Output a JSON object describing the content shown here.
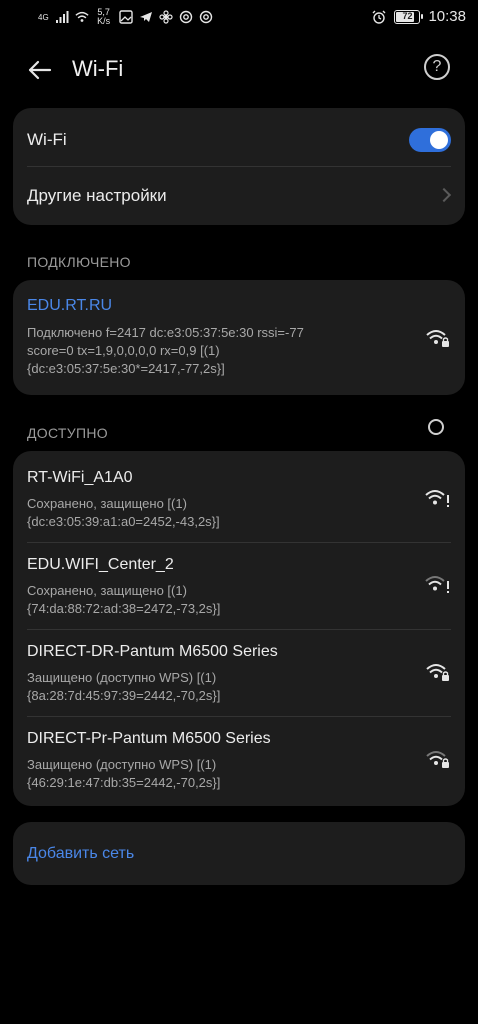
{
  "status_bar": {
    "signal_label": "4G",
    "net_speed_top": "5,7",
    "net_speed_bottom": "K/s",
    "battery": "72",
    "time": "10:38"
  },
  "header": {
    "title": "Wi-Fi",
    "help_symbol": "?"
  },
  "toggle_card": {
    "wifi_label": "Wi-Fi",
    "wifi_enabled": true,
    "other_settings_label": "Другие настройки"
  },
  "connected": {
    "section_title": "ПОДКЛЮЧЕНО",
    "name": "EDU.RT.RU",
    "details": [
      "Подключено f=2417  dc:e3:05:37:5e:30 rssi=-77",
      "score=0 tx=1,9,0,0,0,0 rx=0,9 [(1)",
      "{dc:e3:05:37:5e:30*=2417,-77,2s}]"
    ],
    "icon": "wifi-lock-icon"
  },
  "available": {
    "section_title": "ДОСТУПНО",
    "networks": [
      {
        "name": "RT-WiFi_A1A0",
        "line1": "Сохранено, защищено  [(1)",
        "line2": "{dc:e3:05:39:a1:a0=2452,-43,2s}]",
        "icon": "wifi-alert-icon"
      },
      {
        "name": "EDU.WIFI_Center_2",
        "line1": "Сохранено, защищено  [(1)",
        "line2": "{74:da:88:72:ad:38=2472,-73,2s}]",
        "icon": "wifi-alert-icon"
      },
      {
        "name": "DIRECT-DR-Pantum M6500 Series",
        "line1": "Защищено (доступно WPS)  [(1)",
        "line2": "{8a:28:7d:45:97:39=2442,-70,2s}]",
        "icon": "wifi-lock-icon"
      },
      {
        "name": "DIRECT-Pr-Pantum M6500 Series",
        "line1": "Защищено (доступно WPS)  [(1)",
        "line2": "{46:29:1e:47:db:35=2442,-70,2s}]",
        "icon": "wifi-lock-icon"
      }
    ]
  },
  "add_network": {
    "label": "Добавить сеть"
  },
  "colors": {
    "background": "#000000",
    "card": "#1d1d1d",
    "accent": "#4a87e8",
    "toggle_on": "#2f6fdb"
  }
}
